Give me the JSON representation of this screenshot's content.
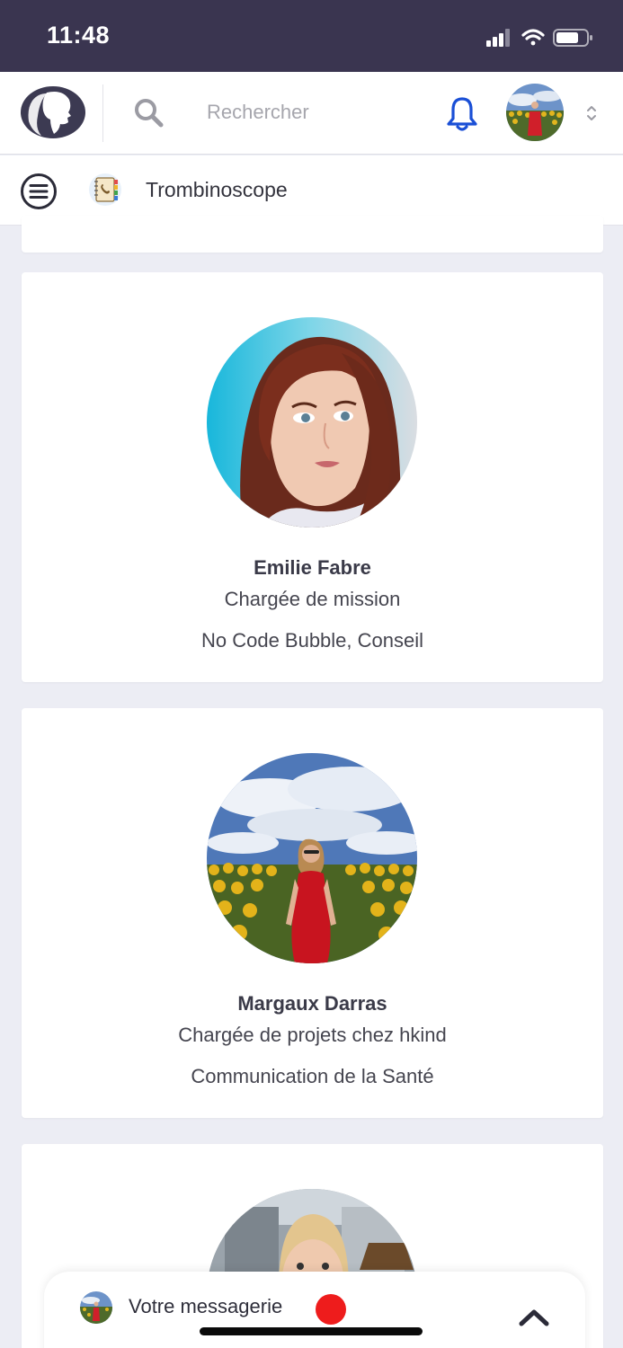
{
  "status_bar": {
    "time": "11:48"
  },
  "header": {
    "search_placeholder": "Rechercher"
  },
  "sub_header": {
    "title": "Trombinoscope"
  },
  "profiles": [
    {
      "name": "Emilie Fabre",
      "role": "Chargée de mission",
      "skills": "No Code Bubble, Conseil"
    },
    {
      "name": "Margaux Darras",
      "role": "Chargée de projets chez hkind",
      "skills": "Communication de la Santé"
    }
  ],
  "messaging": {
    "label": "Votre messagerie"
  },
  "colors": {
    "status_bar": "#3a3550",
    "accent_blue": "#1a4fd6",
    "notification_red": "#ee1c1c",
    "page_bg": "#ecedf4"
  },
  "icons": [
    "logo-icon",
    "search-icon",
    "bell-icon",
    "sort-icon",
    "menu-icon",
    "directory-icon",
    "chevron-up-icon"
  ]
}
